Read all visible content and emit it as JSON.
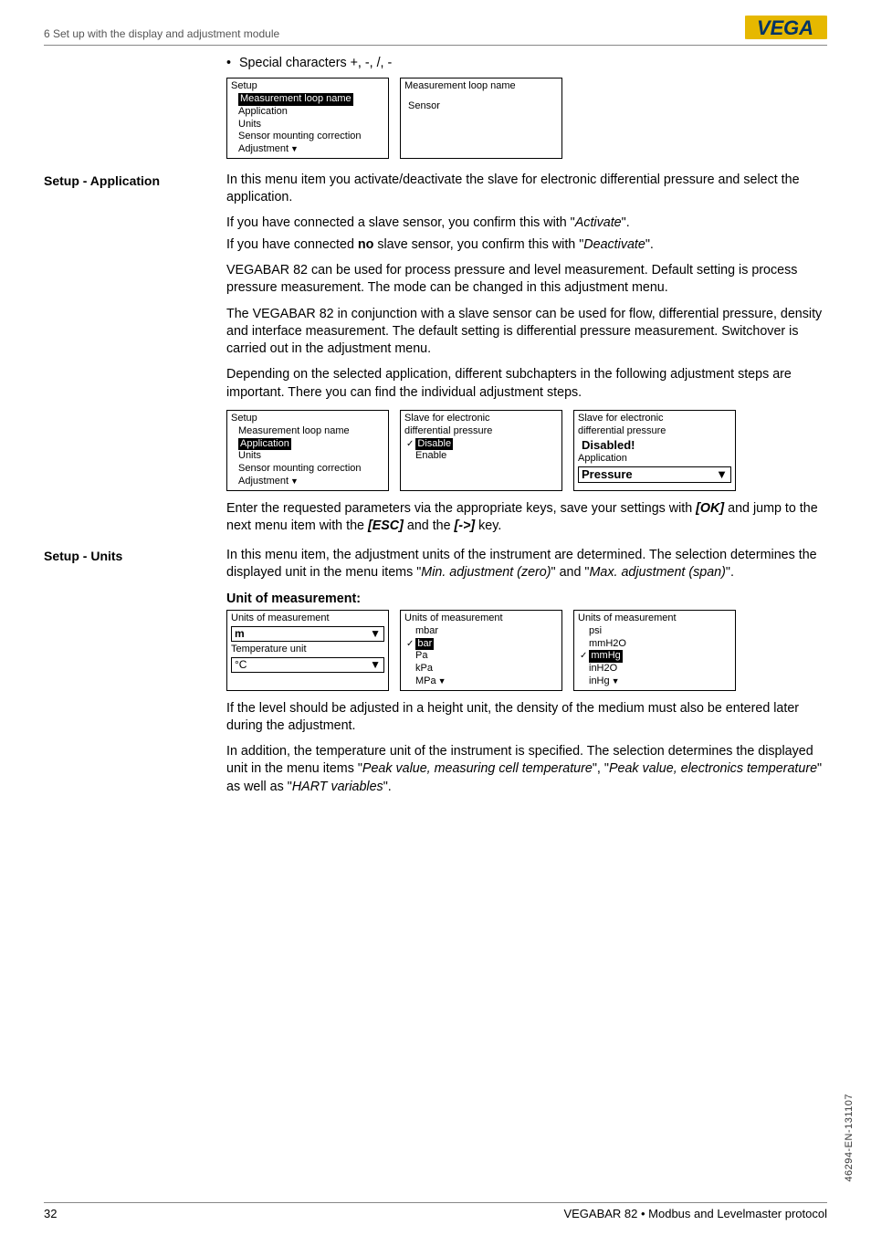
{
  "header": "6 Set up with the display and adjustment module",
  "logo_text": "VEGA",
  "bullet_special": "Special characters +, -, /, -",
  "lcd1a": {
    "title": "Setup",
    "hl": "Measurement loop name",
    "l1": "Application",
    "l2": "Units",
    "l3": "Sensor mounting correction",
    "l4": "Adjustment"
  },
  "lcd1b": {
    "title": "Measurement loop name",
    "l1": "Sensor"
  },
  "section_app_label": "Setup - Application",
  "app_p1": "In this menu item you activate/deactivate the slave for electronic differential pressure and select the application.",
  "app_p2a": "If you have connected a slave sensor, you confirm this with \"",
  "app_p2b": "Activate",
  "app_p2c": "\".",
  "app_p3a": "If you have connected ",
  "app_p3b": "no",
  "app_p3c": " slave sensor, you confirm this with \"",
  "app_p3d": "Deactivate",
  "app_p3e": "\".",
  "app_p4": "VEGABAR 82 can be used for process pressure and level measurement. Default setting is process pressure measurement. The mode can be changed in this adjustment menu.",
  "app_p5": "The VEGABAR 82 in conjunction with a slave sensor can be used for flow, differential pressure, density and interface measurement. The default setting is differential pressure measurement. Switchover is carried out in the adjustment menu.",
  "app_p6": "Depending on the selected application, different subchapters in the following adjustment steps are important. There you can find the individual adjustment steps.",
  "lcd2a": {
    "title": "Setup",
    "l1": "Measurement loop name",
    "hl": "Application",
    "l2": "Units",
    "l3": "Sensor mounting correction",
    "l4": "Adjustment"
  },
  "lcd2b": {
    "title": "Slave for electronic",
    "title2": "differential pressure",
    "hl": "Disable",
    "l1": "Enable"
  },
  "lcd2c": {
    "title": "Slave for electronic",
    "title2": "differential pressure",
    "big1": "Disabled!",
    "l1": "Application",
    "field": "Pressure"
  },
  "app_p7a": "Enter the requested parameters via the appropriate keys, save your settings with ",
  "app_p7b": "[OK]",
  "app_p7c": " and jump to the next menu item with the ",
  "app_p7d": "[ESC]",
  "app_p7e": " and the ",
  "app_p7f": "[->]",
  "app_p7g": " key.",
  "section_units_label": "Setup - Units",
  "units_p1a": "In this menu item, the adjustment units of the instrument are determined. The selection determines the displayed unit in the menu items \"",
  "units_p1b": "Min. adjustment (zero)",
  "units_p1c": "\" and \"",
  "units_p1d": "Max. adjustment (span)",
  "units_p1e": "\".",
  "units_sub": "Unit of measurement:",
  "lcd3a": {
    "title": "Units of measurement",
    "field1": "m",
    "l1": "Temperature unit",
    "field2": "°C"
  },
  "lcd3b": {
    "title": "Units of measurement",
    "l1": "mbar",
    "hl": "bar",
    "l2": "Pa",
    "l3": "kPa",
    "l4": "MPa"
  },
  "lcd3c": {
    "title": "Units of measurement",
    "l1": "psi",
    "l2": "mmH2O",
    "hl": "mmHg",
    "l3": "inH2O",
    "l4": "inHg"
  },
  "units_p2": "If the level should be adjusted in a height unit, the density of the medium must also be entered later during the adjustment.",
  "units_p3a": "In addition, the temperature unit of the instrument is specified. The selection determines the displayed unit in the menu items \"",
  "units_p3b": "Peak value, measuring cell temperature",
  "units_p3c": "\", \"",
  "units_p3d": "Peak value, electronics temperature",
  "units_p3e": "\" as well as \"",
  "units_p3f": "HART variables",
  "units_p3g": "\".",
  "footer_page": "32",
  "footer_text": "VEGABAR 82 • Modbus and Levelmaster protocol",
  "side_code": "46294-EN-131107"
}
